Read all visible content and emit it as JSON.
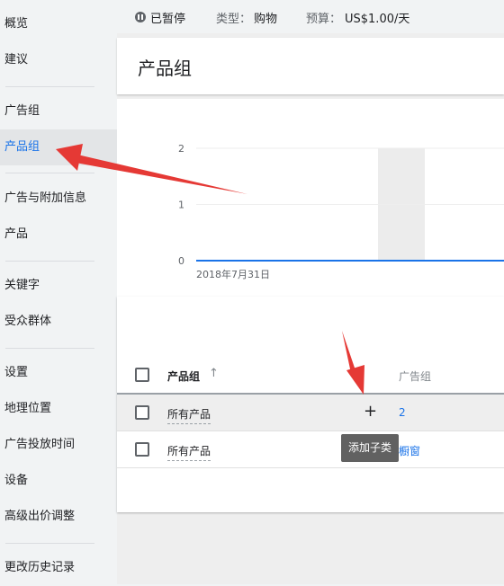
{
  "sidebar": {
    "items": [
      {
        "label": "概览"
      },
      {
        "label": "建议"
      },
      {
        "label": "广告组"
      },
      {
        "label": "产品组"
      },
      {
        "label": "广告与附加信息"
      },
      {
        "label": "产品"
      },
      {
        "label": "关键字"
      },
      {
        "label": "受众群体"
      },
      {
        "label": "设置"
      },
      {
        "label": "地理位置"
      },
      {
        "label": "广告投放时间"
      },
      {
        "label": "设备"
      },
      {
        "label": "高级出价调整"
      },
      {
        "label": "更改历史记录"
      }
    ],
    "active_item": "产品组"
  },
  "status_bar": {
    "status": "已暂停",
    "type_label": "类型：",
    "type_value": "购物",
    "budget_label": "预算：",
    "budget_value": "US$1.00/天"
  },
  "page": {
    "title": "产品组"
  },
  "chart_data": {
    "type": "line",
    "title": "",
    "xlabel": "",
    "ylabel": "",
    "x": [
      "2018年7月31日"
    ],
    "y_ticks": [
      "0",
      "1",
      "2"
    ],
    "ylim": [
      0,
      2
    ],
    "series": [
      {
        "values": [
          0
        ]
      }
    ],
    "grid": true
  },
  "table": {
    "headers": {
      "product_group": "产品组",
      "ad_group": "广告组"
    },
    "rows": [
      {
        "product_group": "所有产品",
        "ad_group": "2"
      },
      {
        "product_group": "所有产品",
        "ad_group": "橱窗"
      }
    ],
    "add_icon": "plus-icon",
    "tooltip": "添加子类"
  },
  "colors": {
    "accent": "#1a73e8",
    "annotation_arrow": "#e53935"
  }
}
